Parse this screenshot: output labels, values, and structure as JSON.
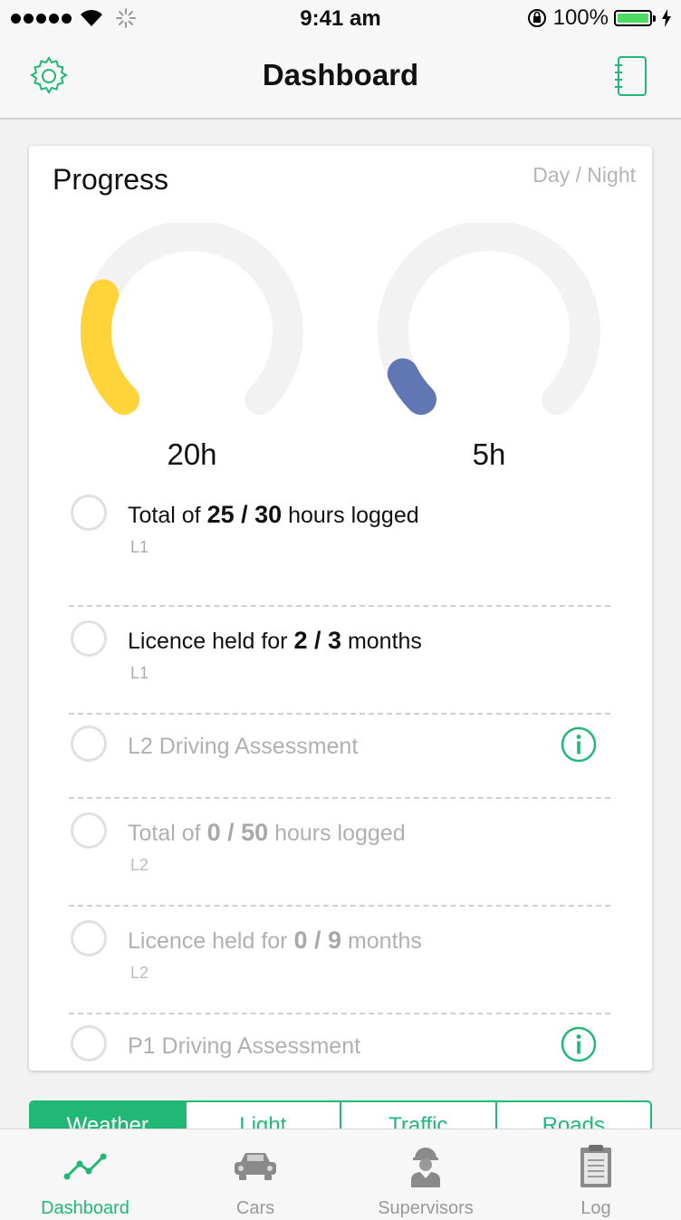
{
  "status_bar": {
    "time": "9:41 am",
    "battery_percent": "100%",
    "signal_bars": 5
  },
  "nav": {
    "title": "Dashboard",
    "left_icon": "gear-icon",
    "right_icon": "notebook-icon"
  },
  "progress": {
    "title": "Progress",
    "toggle_label": "Day / Night",
    "day": {
      "value_label": "20h",
      "fraction": 0.25,
      "color": "#ffd43b"
    },
    "night": {
      "value_label": "5h",
      "fraction": 0.07,
      "color": "#6077b3"
    },
    "items": [
      {
        "pre": "Total of ",
        "bold": "25 / 30",
        "post": " hours logged",
        "sub": "L1",
        "enabled": true,
        "info": false
      },
      {
        "pre": "Licence held for ",
        "bold": "2 / 3",
        "post": " months",
        "sub": "L1",
        "enabled": true,
        "info": false
      },
      {
        "pre": "L2 Driving Assessment",
        "bold": "",
        "post": "",
        "sub": "",
        "enabled": false,
        "info": true
      },
      {
        "pre": "Total of ",
        "bold": "0 / 50",
        "post": " hours logged",
        "sub": "L2",
        "enabled": false,
        "info": false
      },
      {
        "pre": "Licence held for ",
        "bold": "0 / 9",
        "post": " months",
        "sub": "L2",
        "enabled": false,
        "info": false
      },
      {
        "pre": "P1 Driving Assessment",
        "bold": "",
        "post": "",
        "sub": "",
        "enabled": false,
        "info": true
      }
    ]
  },
  "segments": [
    "Weather",
    "Light",
    "Traffic",
    "Roads"
  ],
  "tab_bar": [
    {
      "label": "Dashboard",
      "icon": "chart-line-icon",
      "active": true
    },
    {
      "label": "Cars",
      "icon": "car-icon",
      "active": false
    },
    {
      "label": "Supervisors",
      "icon": "supervisor-icon",
      "active": false
    },
    {
      "label": "Log",
      "icon": "clipboard-icon",
      "active": false
    }
  ],
  "colors": {
    "accent": "#21b876",
    "track": "#f2f2f2"
  }
}
